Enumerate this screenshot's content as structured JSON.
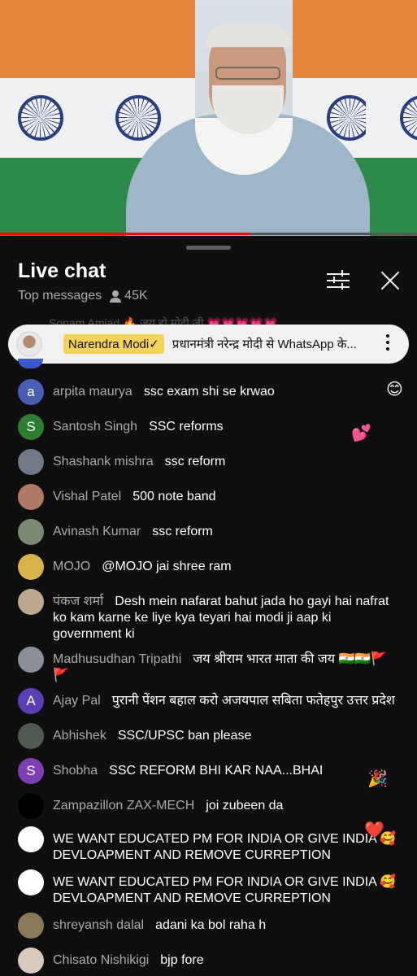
{
  "chat": {
    "title": "Live chat",
    "subtitle": "Top messages",
    "viewers": "45K",
    "faded_text": "Sonam Amjad 🔥  जय हो मोदी जी 💗💗💗💗💗",
    "pinned": {
      "author": "Narendra Modi✓",
      "text": "प्रधानमंत्री नरेन्द्र मोदी से WhatsApp के..."
    },
    "messages": [
      {
        "author": "arpita maurya",
        "text": "ssc exam shi se krwao",
        "avatar_letter": "a",
        "avatar_color": "#4a5eb3"
      },
      {
        "author": "Santosh Singh",
        "text": "SSC reforms",
        "avatar_letter": "S",
        "avatar_color": "#2f7d32"
      },
      {
        "author": "Shashank mishra",
        "text": "ssc reform",
        "avatar_letter": "",
        "avatar_color": "#6f7a86"
      },
      {
        "author": "Vishal Patel",
        "text": "500 note band",
        "avatar_letter": "",
        "avatar_color": "#b07a66"
      },
      {
        "author": "Avinash Kumar",
        "text": "ssc reform",
        "avatar_letter": "",
        "avatar_color": "#7a8a74"
      },
      {
        "author": "MOJO",
        "text": "@MOJO jai shree ram",
        "avatar_letter": "",
        "avatar_color": "#d6b24a"
      },
      {
        "author": "पंकज शर्मा",
        "text": "Desh mein nafarat bahut jada ho gayi hai nafrat ko kam karne ke liye kya teyari hai modi ji aap ki government ki",
        "avatar_letter": "",
        "avatar_color": "#bca88e"
      },
      {
        "author": "Madhusudhan Tripathi",
        "text": "जय श्रीराम भारत माता की जय 🇮🇳🇮🇳🚩 🚩",
        "avatar_letter": "",
        "avatar_color": "#8a8f99"
      },
      {
        "author": "Ajay Pal",
        "text": "पुरानी पेंशन बहाल करो अजयपाल सबिता फतेहपुर उत्तर प्रदेश",
        "avatar_letter": "A",
        "avatar_color": "#5b3fb5"
      },
      {
        "author": "Abhishek",
        "text": "SSC/UPSC ban please",
        "avatar_letter": "",
        "avatar_color": "#4f5a52"
      },
      {
        "author": "Shobha",
        "text": "SSC REFORM BHI KAR NAA...BHAI",
        "avatar_letter": "S",
        "avatar_color": "#7e3fb5"
      },
      {
        "author": "Zampazillon ZAX-MECH",
        "text": "joi zubeen da",
        "avatar_letter": "",
        "avatar_color": "#000000"
      },
      {
        "author": "",
        "text": "WE WANT EDUCATED PM FOR INDIA OR GIVE INDIA 🥰DEVLOAPMENT AND REMOVE CURREPTION",
        "avatar_letter": "",
        "avatar_color": "#ffffff"
      },
      {
        "author": "",
        "text": "WE WANT EDUCATED PM FOR INDIA OR GIVE INDIA 🥰DEVLOAPMENT AND REMOVE CURREPTION",
        "avatar_letter": "",
        "avatar_color": "#ffffff"
      },
      {
        "author": "shreyansh dalal",
        "text": "adani ka bol raha h",
        "avatar_letter": "",
        "avatar_color": "#8a7a5a"
      },
      {
        "author": "Chisato Nishikigi",
        "text": "bjp fore",
        "avatar_letter": "",
        "avatar_color": "#d9c9c0"
      }
    ],
    "floating": [
      "😊",
      "💕",
      "🎉",
      "❤️"
    ]
  }
}
